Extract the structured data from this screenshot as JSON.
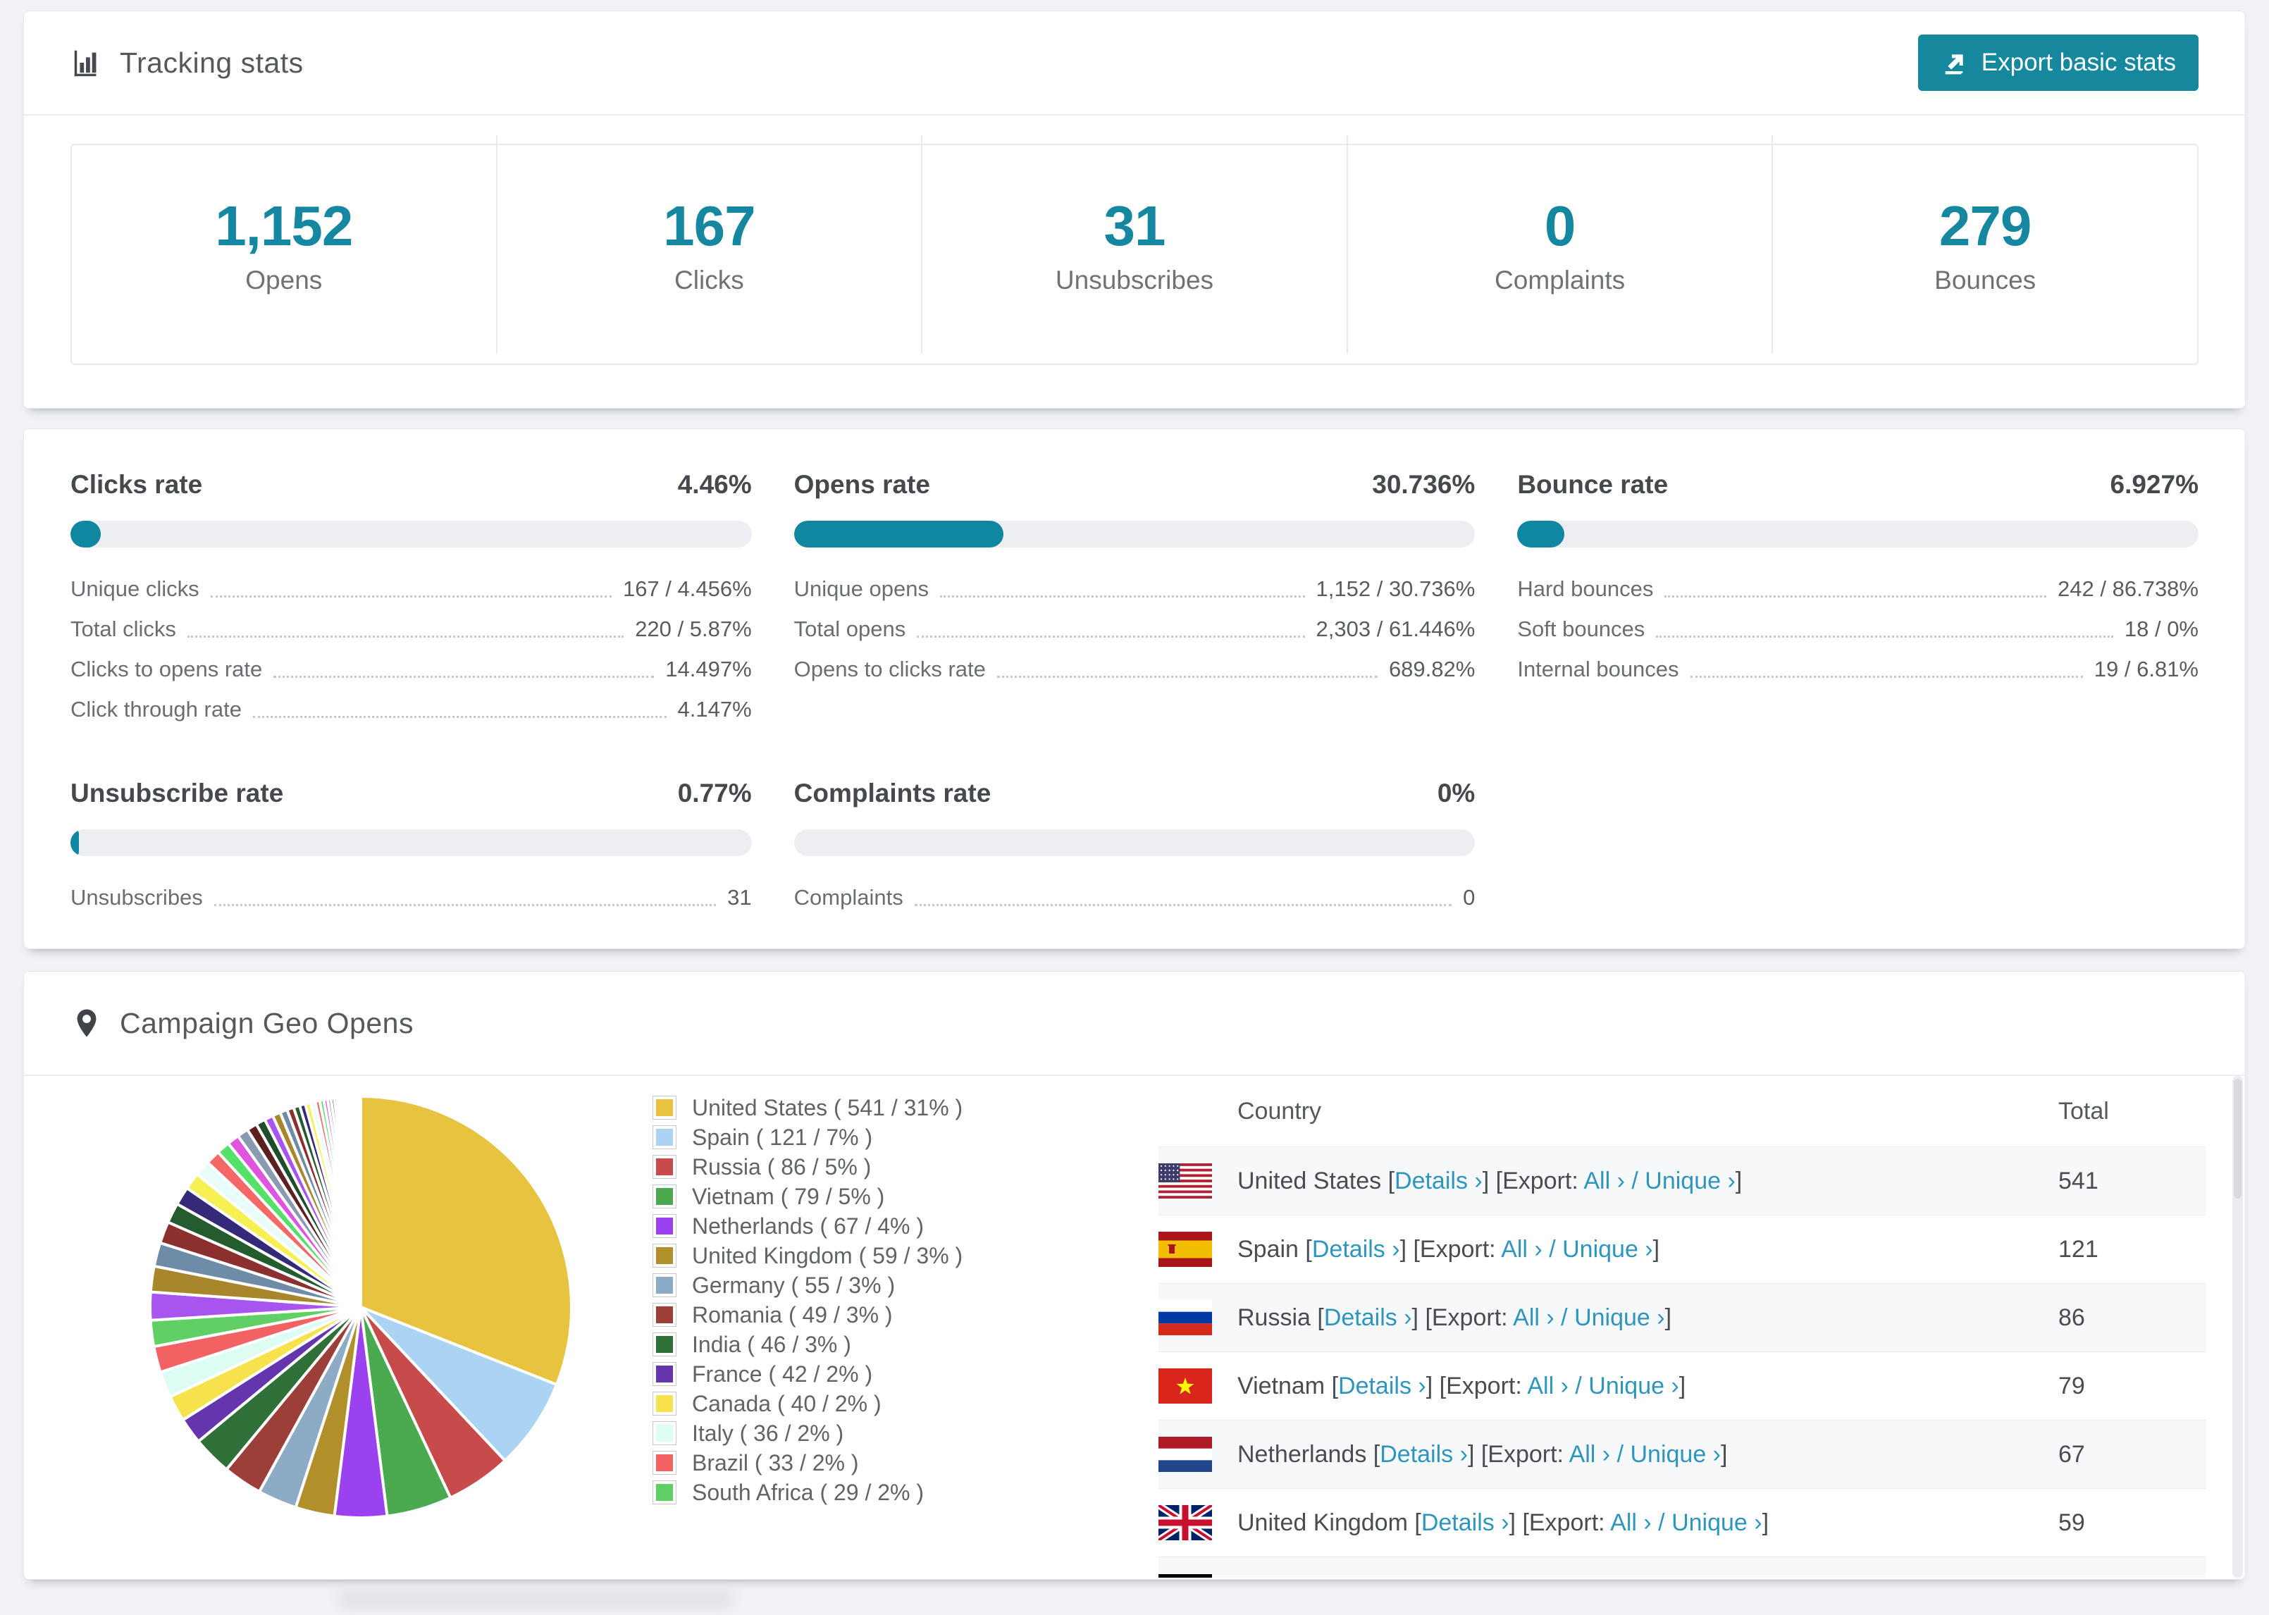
{
  "accent_color": "#15889e",
  "link_color": "#2e95bd",
  "tracking": {
    "title": "Tracking stats",
    "export_button_label": "Export basic stats",
    "stats": [
      {
        "value": "1,152",
        "label": "Opens"
      },
      {
        "value": "167",
        "label": "Clicks"
      },
      {
        "value": "31",
        "label": "Unsubscribes"
      },
      {
        "value": "0",
        "label": "Complaints"
      },
      {
        "value": "279",
        "label": "Bounces"
      }
    ]
  },
  "rates": [
    {
      "title": "Clicks rate",
      "value": "4.46%",
      "percent": 4.46,
      "rows": [
        {
          "label": "Unique clicks",
          "value": "167 / 4.456%"
        },
        {
          "label": "Total clicks",
          "value": "220 / 5.87%"
        },
        {
          "label": "Clicks to opens rate",
          "value": "14.497%"
        },
        {
          "label": "Click through rate",
          "value": "4.147%"
        }
      ]
    },
    {
      "title": "Opens rate",
      "value": "30.736%",
      "percent": 30.736,
      "rows": [
        {
          "label": "Unique opens",
          "value": "1,152 / 30.736%"
        },
        {
          "label": "Total opens",
          "value": "2,303 / 61.446%"
        },
        {
          "label": "Opens to clicks rate",
          "value": "689.82%"
        }
      ]
    },
    {
      "title": "Bounce rate",
      "value": "6.927%",
      "percent": 6.927,
      "rows": [
        {
          "label": "Hard bounces",
          "value": "242 / 86.738%"
        },
        {
          "label": "Soft bounces",
          "value": "18 / 0%"
        },
        {
          "label": "Internal bounces",
          "value": "19 / 6.81%"
        }
      ]
    },
    {
      "title": "Unsubscribe rate",
      "value": "0.77%",
      "percent": 0.77,
      "rows": [
        {
          "label": "Unsubscribes",
          "value": "31"
        }
      ]
    },
    {
      "title": "Complaints rate",
      "value": "0%",
      "percent": 0,
      "rows": [
        {
          "label": "Complaints",
          "value": "0"
        }
      ]
    }
  ],
  "geo": {
    "title": "Campaign Geo Opens",
    "columns": {
      "country": "Country",
      "total": "Total"
    },
    "link_labels": {
      "bracket_open": "[",
      "bracket_close": "]",
      "details": "Details ›",
      "export_prefix": "[Export: ",
      "all": "All ›",
      "separator": " / ",
      "unique": "Unique ›"
    },
    "rows": [
      {
        "country": "United States",
        "flag": "us",
        "total": "541"
      },
      {
        "country": "Spain",
        "flag": "es",
        "total": "121"
      },
      {
        "country": "Russia",
        "flag": "ru",
        "total": "86"
      },
      {
        "country": "Vietnam",
        "flag": "vn",
        "total": "79"
      },
      {
        "country": "Netherlands",
        "flag": "nl",
        "total": "67"
      },
      {
        "country": "United Kingdom",
        "flag": "gb",
        "total": "59"
      }
    ],
    "partial_row": {
      "flag": "de"
    }
  },
  "chart_data": {
    "type": "pie",
    "title": "Campaign Geo Opens",
    "legend_position": "right",
    "start_angle_deg": 0,
    "direction": "clockwise",
    "legend_format": "{name} ( {value} / {percent}% )",
    "series": [
      {
        "name": "United States",
        "value": 541,
        "percent": 31,
        "color": "#e7c340"
      },
      {
        "name": "Spain",
        "value": 121,
        "percent": 7,
        "color": "#abd4f2"
      },
      {
        "name": "Russia",
        "value": 86,
        "percent": 5,
        "color": "#c74b4b"
      },
      {
        "name": "Vietnam",
        "value": 79,
        "percent": 5,
        "color": "#4ba94f"
      },
      {
        "name": "Netherlands",
        "value": 67,
        "percent": 4,
        "color": "#9a41f0"
      },
      {
        "name": "United Kingdom",
        "value": 59,
        "percent": 3,
        "color": "#b1902c"
      },
      {
        "name": "Germany",
        "value": 55,
        "percent": 3,
        "color": "#8dabc4"
      },
      {
        "name": "Romania",
        "value": 49,
        "percent": 3,
        "color": "#9d3f39"
      },
      {
        "name": "India",
        "value": 46,
        "percent": 3,
        "color": "#2e7037"
      },
      {
        "name": "France",
        "value": 42,
        "percent": 2,
        "color": "#6535ad"
      },
      {
        "name": "Canada",
        "value": 40,
        "percent": 2,
        "color": "#f6e24c"
      },
      {
        "name": "Italy",
        "value": 36,
        "percent": 2,
        "color": "#dcfcf4"
      },
      {
        "name": "Brazil",
        "value": 33,
        "percent": 2,
        "color": "#f26262"
      },
      {
        "name": "South Africa",
        "value": 29,
        "percent": 2,
        "color": "#60d066"
      }
    ],
    "unlabeled_small_slices": {
      "approx_total_percent": 26,
      "visible_slice_count": 42,
      "decay": 0.92,
      "palette": [
        "#a855f0",
        "#a8872c",
        "#6e8ca8",
        "#8c2f2f",
        "#245c2e",
        "#352a7a",
        "#f7f052",
        "#e8fcfa",
        "#f56868",
        "#55e06a",
        "#e055e0",
        "#8a9ab0",
        "#5c2020",
        "#1e4f2a"
      ]
    }
  }
}
